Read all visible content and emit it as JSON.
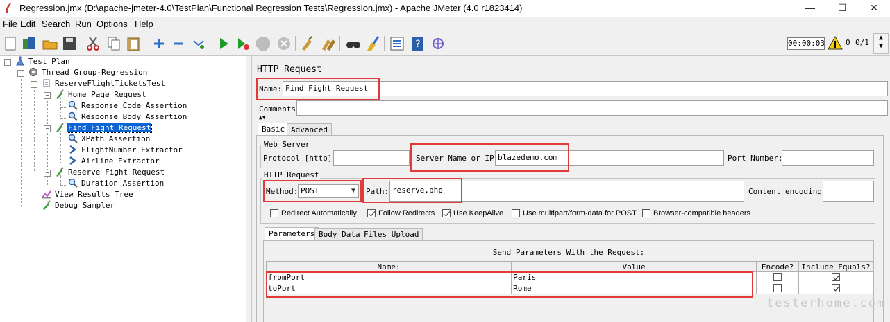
{
  "window": {
    "title": "Regression.jmx (D:\\apache-jmeter-4.0\\TestPlan\\Functional Regression Tests\\Regression.jmx) - Apache JMeter (4.0 r1823414)",
    "minimize": "—",
    "maximize": "☐",
    "close": "✕"
  },
  "menu": [
    "File",
    "Edit",
    "Search",
    "Run",
    "Options",
    "Help"
  ],
  "toolbar": {
    "icons": [
      "new-icon",
      "templates-icon",
      "open-icon",
      "save-icon",
      "cut-icon",
      "copy-icon",
      "paste-icon",
      "expand-icon",
      "collapse-icon",
      "toggle-icon",
      "start-icon",
      "start-no-pause-icon",
      "stop-icon",
      "shutdown-icon",
      "clear-icon",
      "clear-all-icon",
      "search-icon",
      "reset-search-icon",
      "function-helper-icon",
      "help-icon",
      "remote-icon"
    ],
    "timer": "00:00:03",
    "error_count": "0",
    "threads": "0/1"
  },
  "tree": {
    "nodes": [
      {
        "label": "Test Plan",
        "icon": "test-plan-icon"
      },
      {
        "label": "Thread Group-Regression",
        "icon": "thread-group-icon"
      },
      {
        "label": "ReserveFlightTicketsTest",
        "icon": "transaction-controller-icon"
      },
      {
        "label": "Home Page Request",
        "icon": "sampler-icon"
      },
      {
        "label": "Response Code Assertion",
        "icon": "assertion-icon"
      },
      {
        "label": "Response Body Assertion",
        "icon": "assertion-icon"
      },
      {
        "label": "Find Fight Request",
        "icon": "sampler-icon"
      },
      {
        "label": "XPath Assertion",
        "icon": "assertion-icon"
      },
      {
        "label": "FlightNumber Extractor",
        "icon": "extractor-icon"
      },
      {
        "label": "Airline Extractor",
        "icon": "extractor-icon"
      },
      {
        "label": "Reserve Fight Request",
        "icon": "sampler-icon"
      },
      {
        "label": "Duration Assertion",
        "icon": "assertion-icon"
      },
      {
        "label": "View Results Tree",
        "icon": "listener-icon"
      },
      {
        "label": "Debug Sampler",
        "icon": "sampler-icon"
      }
    ]
  },
  "panel": {
    "title": "HTTP Request",
    "name_label": "Name:",
    "name_value": "Find Fight Request",
    "comments_label": "Comments:",
    "tabs": [
      "Basic",
      "Advanced"
    ],
    "web_server": {
      "legend": "Web Server",
      "protocol_label": "Protocol [http]:",
      "protocol_value": "",
      "server_label": "Server Name or IP:",
      "server_value": "blazedemo.com",
      "port_label": "Port Number:",
      "port_value": ""
    },
    "http_request": {
      "legend": "HTTP Request",
      "method_label": "Method:",
      "method_value": "POST",
      "path_label": "Path:",
      "path_value": "reserve.php",
      "encoding_label": "Content encoding:",
      "encoding_value": ""
    },
    "options": [
      {
        "label": "Redirect Automatically",
        "checked": false
      },
      {
        "label": "Follow Redirects",
        "checked": true
      },
      {
        "label": "Use KeepAlive",
        "checked": true
      },
      {
        "label": "Use multipart/form-data for POST",
        "checked": false
      },
      {
        "label": "Browser-compatible headers",
        "checked": false
      }
    ],
    "subtabs": [
      "Parameters",
      "Body Data",
      "Files Upload"
    ],
    "params_caption": "Send Parameters With the Request:",
    "params_headers": [
      "Name:",
      "Value",
      "Encode?",
      "Include Equals?"
    ],
    "params_rows": [
      {
        "name": "fromPort",
        "value": "Paris",
        "encode": false,
        "include_equals": true
      },
      {
        "name": "toPort",
        "value": "Rome",
        "encode": false,
        "include_equals": true
      }
    ]
  },
  "watermark": "testerhome.com"
}
